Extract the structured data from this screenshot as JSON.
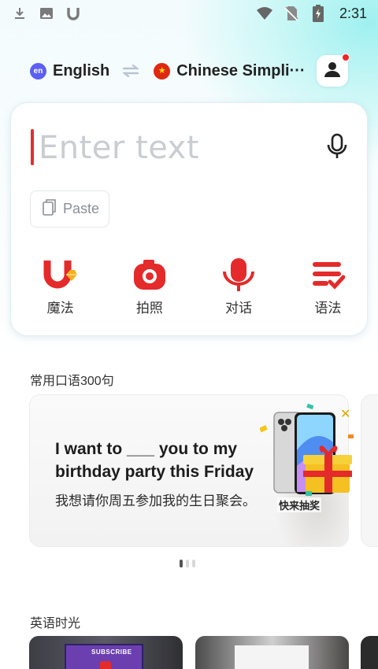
{
  "status_bar": {
    "time": "2:31",
    "left_icons": [
      "download-icon",
      "image-icon",
      "app-u-icon"
    ],
    "right_icons": [
      "wifi-icon",
      "no-sim-icon",
      "battery-charging-icon"
    ]
  },
  "language_bar": {
    "source_badge": "en",
    "source_language": "English",
    "target_language": "Chinese Simpli···",
    "swap_icon": "swap-arrows-icon"
  },
  "input_card": {
    "placeholder": "Enter text",
    "paste_label": "Paste",
    "tools": [
      {
        "label": "魔法",
        "icon": "magic-u-icon"
      },
      {
        "label": "拍照",
        "icon": "camera-icon"
      },
      {
        "label": "对话",
        "icon": "conversation-mic-icon"
      },
      {
        "label": "语法",
        "icon": "grammar-check-icon"
      }
    ]
  },
  "phrases_section": {
    "title": "常用口语300句",
    "card": {
      "english": "I want to ___ you to my birthday party this Friday.",
      "english_line1": "I want to ___ you to my",
      "english_line2": "birthday party this Friday",
      "chinese": "我想请你周五参加我的生日聚会。"
    },
    "promo_label": "快来抽奖",
    "page_count": 3,
    "active_page": 1
  },
  "video_section": {
    "title": "英语时光",
    "thumb1_text": "SUBSCRIBE"
  },
  "colors": {
    "accent_red": "#e82a2a",
    "badge_blue": "#5b5ff3",
    "glow_cyan": "#9ff0f0"
  }
}
